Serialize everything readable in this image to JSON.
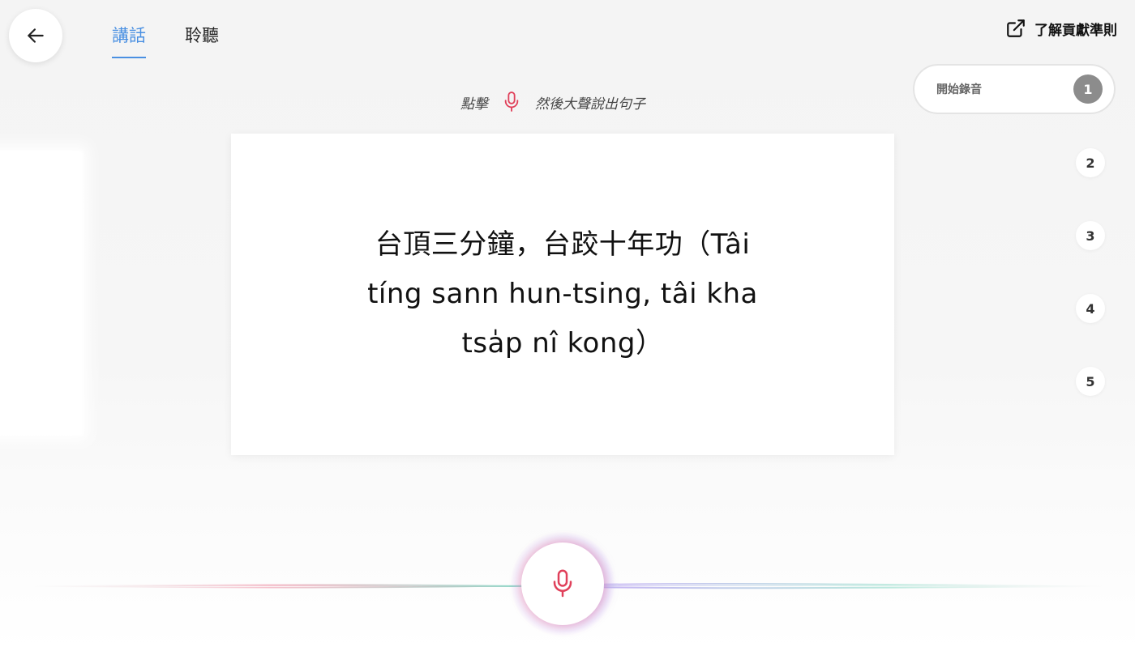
{
  "nav": {
    "back_icon": "arrow-left-icon",
    "tabs": [
      {
        "label": "講話",
        "active": true
      },
      {
        "label": "聆聽",
        "active": false
      }
    ],
    "guidelines_label": "了解貢獻準則",
    "guidelines_icon": "external-link-icon"
  },
  "instruction": {
    "before": "點擊",
    "icon": "microphone-icon",
    "after": "然後大聲說出句子"
  },
  "sentence": {
    "text": "台頂三分鐘，台跤十年功（Tâi tíng sann hun-tsing, tâi kha tsa̍p nî kong）"
  },
  "steps": {
    "current_label": "開始錄音",
    "items": [
      "1",
      "2",
      "3",
      "4",
      "5"
    ]
  },
  "record": {
    "icon": "microphone-icon"
  },
  "colors": {
    "accent": "#4a90e2",
    "mic": "#e0405a",
    "step_current": "#8c8c8c"
  }
}
